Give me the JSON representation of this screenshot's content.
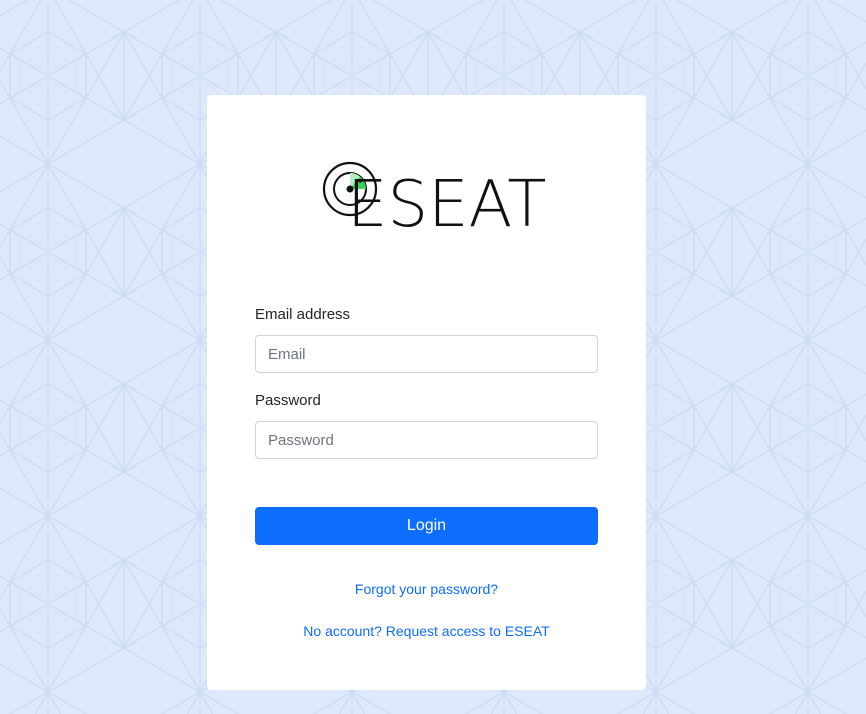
{
  "colors": {
    "background": "#dde9fb",
    "card": "#ffffff",
    "primary": "#0d6efd",
    "logo_accent": "#3ccf5a"
  },
  "logo": {
    "text": "ESEAT",
    "icon": "radar-icon"
  },
  "form": {
    "email": {
      "label": "Email address",
      "value": "",
      "placeholder": "Email"
    },
    "password": {
      "label": "Password",
      "value": "",
      "placeholder": "Password"
    },
    "login_label": "Login"
  },
  "links": {
    "forgot_password": "Forgot your password?",
    "request_access": "No account? Request access to ESEAT"
  }
}
